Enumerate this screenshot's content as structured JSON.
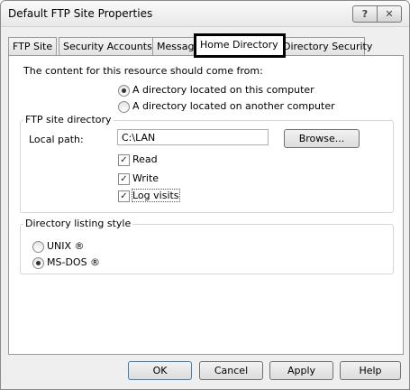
{
  "window": {
    "title": "Default FTP Site Properties"
  },
  "titlebar": {
    "help_label": "?",
    "close_label": "✕"
  },
  "tabs": [
    {
      "label": "FTP Site"
    },
    {
      "label": "Security Accounts"
    },
    {
      "label": "Message"
    },
    {
      "label": "Home Directory"
    },
    {
      "label": "Directory Security"
    }
  ],
  "home": {
    "content_from_label": "The content for this resource should come from:",
    "options": [
      {
        "label": "A directory located on this computer",
        "selected": true
      },
      {
        "label": "A directory located on another computer",
        "selected": false
      }
    ]
  },
  "ftp_dir": {
    "legend": "FTP site directory",
    "local_path_label": "Local path:",
    "local_path_value": "C:\\LAN",
    "browse_label": "Browse...",
    "checks": [
      {
        "label": "Read",
        "checked": true
      },
      {
        "label": "Write",
        "checked": true
      },
      {
        "label": "Log visits",
        "checked": true
      }
    ]
  },
  "listing": {
    "legend": "Directory listing style",
    "options": [
      {
        "label": "UNIX ®",
        "selected": false
      },
      {
        "label": "MS-DOS ®",
        "selected": true
      }
    ]
  },
  "buttons": {
    "ok": "OK",
    "cancel": "Cancel",
    "apply": "Apply",
    "help": "Help"
  }
}
